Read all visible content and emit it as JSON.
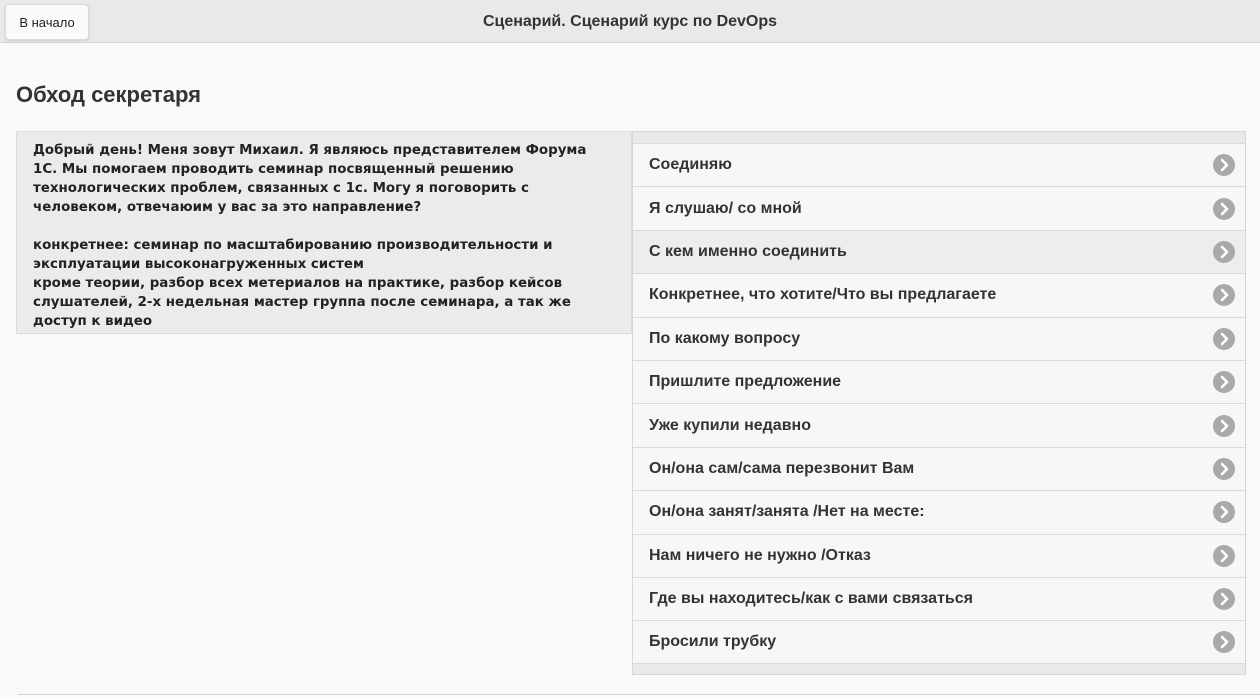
{
  "header": {
    "home_label": "В начало",
    "title": "Сценарий. Сценарий курс по DevOps"
  },
  "page_title": "Обход секретаря",
  "script": {
    "paragraph_1": "Добрый день! Меня зовут Михаил. Я являюсь представителем Форума 1С. Мы помогаем проводить семинар посвященный решению технологических проблем, связанных с 1с. Могу  я поговорить с человеком, отвечаюим у вас за это направление?",
    "paragraph_2": "конкретнее:   семинар по масштабированию производительности и эксплуатации высоконагруженных систем",
    "paragraph_3": "кроме теории, разбор всех метериалов на практике, разбор кейсов слушателей, 2-х недельная мастер группа после семинара, а так же доступ к видео"
  },
  "answers": [
    {
      "label": "Соединяю",
      "icon": "chevron-right-circle-icon"
    },
    {
      "label": "Я слушаю/ со мной",
      "icon": "chevron-right-circle-icon"
    },
    {
      "label": "С кем именно соединить",
      "icon": "chevron-right-circle-icon"
    },
    {
      "label": "Конкретнее, что хотите/Что вы предлагаете",
      "icon": "chevron-right-circle-icon"
    },
    {
      "label": "По какому вопросу",
      "icon": "chevron-right-circle-icon"
    },
    {
      "label": "Пришлите предложение",
      "icon": "chevron-right-circle-icon"
    },
    {
      "label": "Уже купили недавно",
      "icon": "chevron-right-circle-icon"
    },
    {
      "label": "Он/она сам/сама перезвонит Вам",
      "icon": "chevron-right-circle-icon"
    },
    {
      "label": "Он/она занят/занята /Нет на месте:",
      "icon": "chevron-right-circle-icon"
    },
    {
      "label": "Нам ничего не нужно /Отказ",
      "icon": "chevron-right-circle-icon"
    },
    {
      "label": "Где вы находитесь/как с вами связаться",
      "icon": "chevron-right-circle-icon"
    },
    {
      "label": "Бросили трубку",
      "icon": "chevron-right-circle-icon"
    }
  ],
  "colors": {
    "header_bg": "#e9e9e9",
    "page_bg": "#f9f9f9",
    "panel_bg": "#ebebeb",
    "chevron_bg": "#a9a9a9"
  }
}
